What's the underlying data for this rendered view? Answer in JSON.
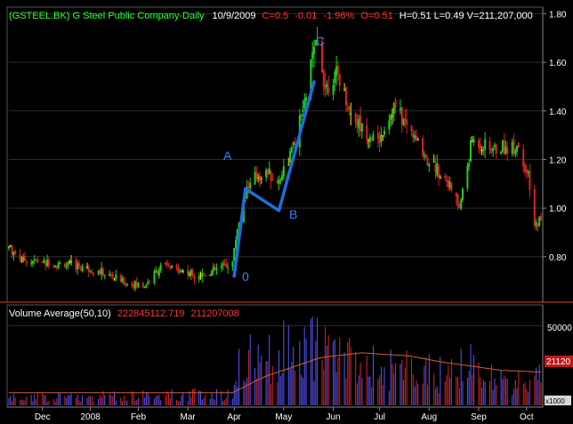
{
  "header": {
    "symbol": "(GSTEEL.BK) G Steel Public Company-Daily",
    "date": "10/9/2009",
    "close": "C=0.5",
    "change": "-0.01",
    "change_pct": "-1.96%",
    "open": "O=0.51",
    "hlv": "H=0.51 L=0.49 V=211,207,000"
  },
  "volume_header": {
    "label": "Volume Average(50,10)",
    "avg_value": "222845112.719",
    "current_value": "211207008"
  },
  "annotations": {
    "wave_0": "0",
    "wave_a": "A",
    "wave_b": "B",
    "wave_c": "C"
  },
  "volume_axis": {
    "tick": "50000",
    "current_badge": "21120",
    "scale_badge": "x1000"
  },
  "colors": {
    "up": "#22cc22",
    "down": "#dd2222",
    "neutral": "#e8e800",
    "vol_up": "#5555ff",
    "vol_down": "#dd2222",
    "avg_line": "#d06030",
    "wave_line": "#1e6fd9",
    "label_blue": "#3a7ff0",
    "header_red": "#ff3333"
  },
  "chart_data": [
    {
      "type": "candlestick",
      "title": "(GSTEEL.BK) G Steel Public Company-Daily",
      "ylim": [
        0.62,
        1.82
      ],
      "yticks": [
        0.8,
        1.0,
        1.2,
        1.4,
        1.6,
        1.8
      ],
      "ytick_labels": [
        "0.80",
        "1.00",
        "1.20",
        "1.40",
        "1.60",
        "1.80"
      ],
      "x_labels": [
        "Dec",
        "2008",
        "Feb",
        "Mar",
        "Apr",
        "May",
        "Jun",
        "Jul",
        "Aug",
        "Sep",
        "Oct"
      ],
      "x_label_dates": [
        "2007-12-03",
        "2008-01-02",
        "2008-02-01",
        "2008-03-03",
        "2008-04-01",
        "2008-05-02",
        "2008-06-02",
        "2008-07-01",
        "2008-08-01",
        "2008-09-01",
        "2008-10-01"
      ],
      "xlim": [
        "2007-11-12",
        "2008-10-10"
      ],
      "grid": true,
      "price_anchors": [
        [
          "2007-11-12",
          0.84
        ],
        [
          "2007-11-20",
          0.79
        ],
        [
          "2007-12-10",
          0.77
        ],
        [
          "2007-12-28",
          0.76
        ],
        [
          "2008-01-15",
          0.72
        ],
        [
          "2008-01-25",
          0.69
        ],
        [
          "2008-02-05",
          0.68
        ],
        [
          "2008-02-15",
          0.76
        ],
        [
          "2008-02-25",
          0.75
        ],
        [
          "2008-03-05",
          0.73
        ],
        [
          "2008-03-15",
          0.73
        ],
        [
          "2008-03-25",
          0.76
        ],
        [
          "2008-03-31",
          0.78
        ],
        [
          "2008-04-03",
          0.92
        ],
        [
          "2008-04-08",
          1.07
        ],
        [
          "2008-04-15",
          1.13
        ],
        [
          "2008-04-22",
          1.15
        ],
        [
          "2008-04-28",
          1.1
        ],
        [
          "2008-05-08",
          1.25
        ],
        [
          "2008-05-15",
          1.43
        ],
        [
          "2008-05-19",
          1.6
        ],
        [
          "2008-05-23",
          1.68
        ],
        [
          "2008-05-28",
          1.5
        ],
        [
          "2008-06-05",
          1.55
        ],
        [
          "2008-06-12",
          1.4
        ],
        [
          "2008-06-20",
          1.33
        ],
        [
          "2008-06-30",
          1.27
        ],
        [
          "2008-07-10",
          1.42
        ],
        [
          "2008-07-20",
          1.32
        ],
        [
          "2008-07-31",
          1.2
        ],
        [
          "2008-08-12",
          1.12
        ],
        [
          "2008-08-20",
          1.0
        ],
        [
          "2008-08-28",
          1.28
        ],
        [
          "2008-09-08",
          1.24
        ],
        [
          "2008-09-18",
          1.25
        ],
        [
          "2008-09-26",
          1.26
        ],
        [
          "2008-10-02",
          1.12
        ],
        [
          "2008-10-06",
          0.92
        ],
        [
          "2008-10-09",
          0.95
        ]
      ],
      "wave_points": [
        {
          "label": "0",
          "date": "2008-04-01",
          "price": 0.72
        },
        {
          "label": "A",
          "date": "2008-04-08",
          "price": 1.08
        },
        {
          "label": "B",
          "date": "2008-04-29",
          "price": 0.99
        },
        {
          "label": "C",
          "date": "2008-05-21",
          "price": 1.52
        }
      ]
    },
    {
      "type": "bar",
      "title": "Volume Average(50,10)",
      "yunit": "x1000",
      "ylim": [
        0,
        62000
      ],
      "ytick": 50000,
      "volume_anchors": [
        [
          "2007-11-12",
          5000
        ],
        [
          "2008-03-31",
          8000
        ],
        [
          "2008-04-05",
          30000
        ],
        [
          "2008-05-20",
          42000
        ],
        [
          "2008-06-20",
          28000
        ],
        [
          "2008-07-20",
          24000
        ],
        [
          "2008-08-10",
          22000
        ],
        [
          "2008-08-25",
          28000
        ],
        [
          "2008-09-15",
          16000
        ],
        [
          "2008-10-09",
          21000
        ]
      ],
      "average_anchors": [
        [
          "2007-11-12",
          8000
        ],
        [
          "2008-03-31",
          8000
        ],
        [
          "2008-04-20",
          18000
        ],
        [
          "2008-05-25",
          30000
        ],
        [
          "2008-06-20",
          33000
        ],
        [
          "2008-07-20",
          31000
        ],
        [
          "2008-08-10",
          27000
        ],
        [
          "2008-08-25",
          25000
        ],
        [
          "2008-09-15",
          22000
        ],
        [
          "2008-10-09",
          21000
        ]
      ]
    }
  ]
}
